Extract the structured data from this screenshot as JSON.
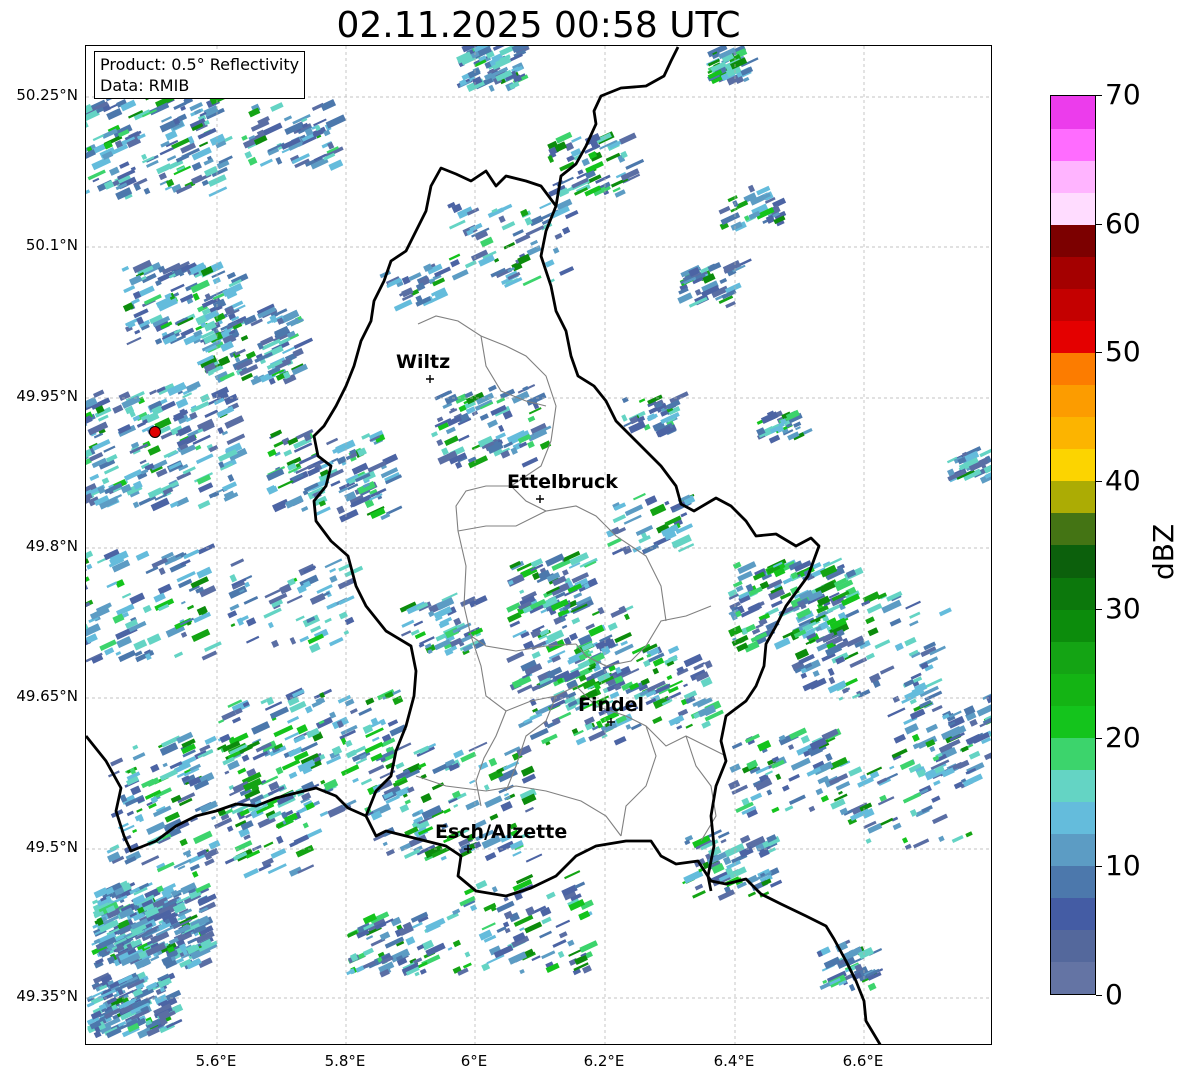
{
  "title": "02.11.2025 00:58 UTC",
  "info": {
    "product": "Product: 0.5° Reflectivity",
    "data": "Data: RMIB"
  },
  "lat_ticks": [
    "50.25°N",
    "50.1°N",
    "49.95°N",
    "49.8°N",
    "49.65°N",
    "49.5°N",
    "49.35°N"
  ],
  "lon_ticks": [
    "5.6°E",
    "5.8°E",
    "6°E",
    "6.2°E",
    "6.4°E",
    "6.6°E"
  ],
  "cities": [
    {
      "name": "Wiltz"
    },
    {
      "name": "Ettelbruck"
    },
    {
      "name": "Findel"
    },
    {
      "name": "Esch/Alzette"
    }
  ],
  "colorbar": {
    "label": "dBZ",
    "ticks": [
      "0",
      "10",
      "20",
      "30",
      "40",
      "50",
      "60",
      "70"
    ],
    "colors": [
      "#6474a4",
      "#54689c",
      "#445ca4",
      "#4c78ac",
      "#5c9cc4",
      "#64bcdc",
      "#64d4c4",
      "#3cd46c",
      "#14c41c",
      "#14b414",
      "#14a414",
      "#0c8c0c",
      "#0c780c",
      "#0c600c",
      "#447414",
      "#acac04",
      "#fcd400",
      "#fcb400",
      "#fc9c00",
      "#fc7c00",
      "#e40000",
      "#c40000",
      "#a40000",
      "#7c0000",
      "#ffdcff",
      "#ffb4ff",
      "#ff6cff",
      "#ec3cec"
    ]
  },
  "radar_site_color": "#e00000"
}
